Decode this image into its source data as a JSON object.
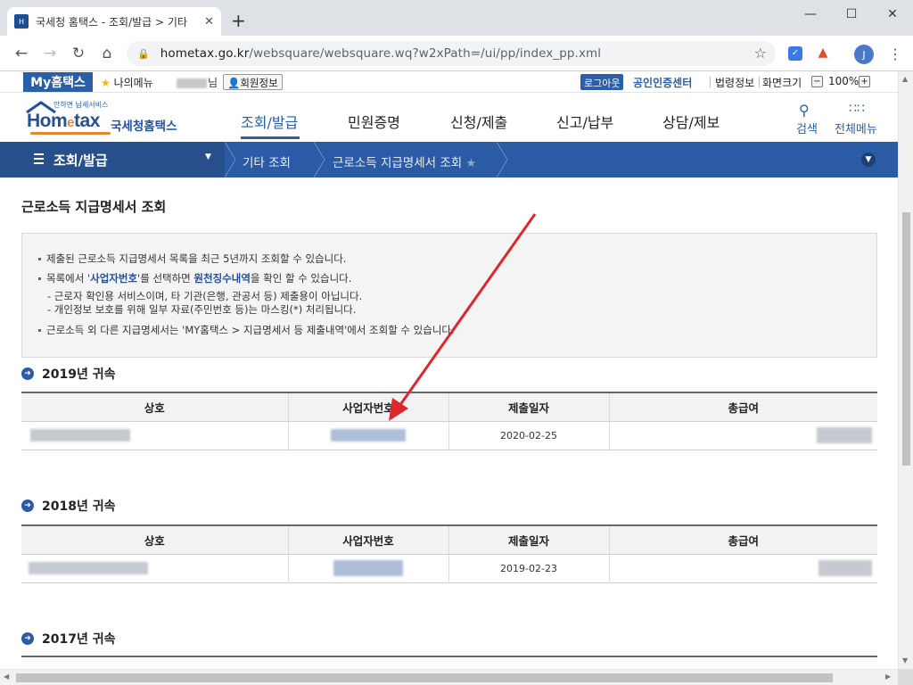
{
  "browser": {
    "tab_title": "국세청 홈택스 - 조회/발급 > 기타",
    "tab_close": "✕",
    "new_tab": "+",
    "url_host": "hometax.go.kr",
    "url_path": "/websquare/websquare.wq?w2xPath=/ui/pp/index_pp.xml",
    "avatar_letter": "J"
  },
  "utilbar": {
    "my_hometax": "My홈택스",
    "my_menu": "나의메뉴",
    "user_suffix": "님",
    "member_info": "회원정보",
    "logout": "로그아웃",
    "cert_center": "공인인증센터",
    "law_info": "법령정보",
    "screen_size": "화면크기",
    "zoom_minus": "−",
    "zoom_value": "100%",
    "zoom_plus": "+"
  },
  "header": {
    "logo_tagline": "안하면 납세서비스",
    "logo_brand_1": "Hom",
    "logo_brand_e": "e",
    "logo_brand_2": "tax",
    "logo_nts": "국세청홈택스",
    "gnb": [
      "조회/발급",
      "민원증명",
      "신청/제출",
      "신고/납부",
      "상담/제보"
    ],
    "search": "검색",
    "all_menu": "전체메뉴"
  },
  "lnb": {
    "main": "조회/발급",
    "crumb1": "기타 조회",
    "crumb2": "근로소득 지급명세서 조회"
  },
  "content": {
    "page_title": "근로소득 지급명세서 조회",
    "notice": {
      "line1": "제출된 근로소득 지급명세서 목록을 최근 5년까지 조회할 수 있습니다.",
      "line2_pre": "목록에서 '",
      "line2_b1": "사업자번호",
      "line2_mid": "'를 선택하면 ",
      "line2_b2": "원천징수내역",
      "line2_post": "을 확인 할 수 있습니다.",
      "sub1": "- 근로자 확인용 서비스이며, 타 기관(은행, 관공서 등) 제출용이 아닙니다.",
      "sub2": "- 개인정보 보호를 위해 일부 자료(주민번호 등)는 마스킹(*) 처리됩니다.",
      "line3": "근로소득 외 다른 지급명세서는 'MY홈택스 > 지급명세서 등 제출내역'에서 조회할 수 있습니다."
    },
    "columns": [
      "상호",
      "사업자번호",
      "제출일자",
      "총급여"
    ],
    "sections": [
      {
        "title": "2019년 귀속",
        "rows": [
          {
            "date": "2020-02-25"
          }
        ]
      },
      {
        "title": "2018년 귀속",
        "rows": [
          {
            "date": "2019-02-23"
          }
        ]
      },
      {
        "title": "2017년 귀속",
        "rows": []
      }
    ]
  },
  "colors": {
    "brand_blue": "#295ea8",
    "lnb_dark": "#274f8c",
    "annotation_arrow": "#e0262b"
  }
}
